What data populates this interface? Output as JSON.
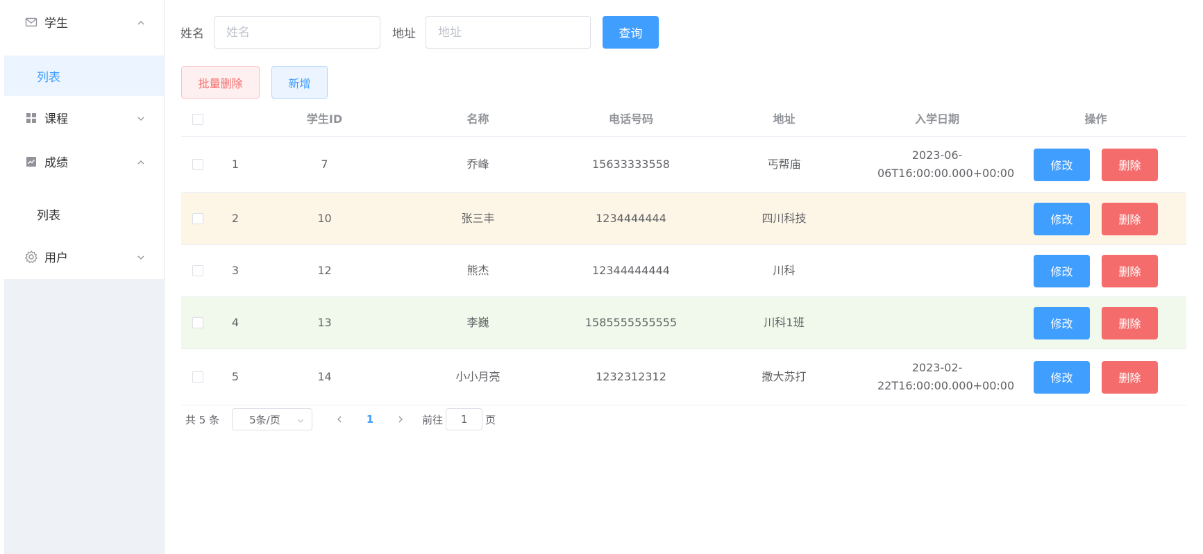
{
  "sidebar": {
    "menus": [
      {
        "title": "学生",
        "expanded": true,
        "icon": "mail-icon",
        "children": [
          "列表"
        ]
      },
      {
        "title": "课程",
        "expanded": false,
        "icon": "grid-icon",
        "children": []
      },
      {
        "title": "成绩",
        "expanded": true,
        "icon": "chart-icon",
        "children": [
          "列表"
        ]
      },
      {
        "title": "用户",
        "expanded": false,
        "icon": "gear-icon",
        "children": []
      }
    ]
  },
  "search": {
    "name_label": "姓名",
    "name_placeholder": "姓名",
    "addr_label": "地址",
    "addr_placeholder": "地址",
    "query_button": "查询"
  },
  "actions": {
    "batch_delete": "批量删除",
    "add": "新增"
  },
  "table": {
    "headers": [
      "学生ID",
      "名称",
      "电话号码",
      "地址",
      "入学日期",
      "操作"
    ],
    "rows": [
      {
        "index": "1",
        "id": "7",
        "name": "乔峰",
        "phone": "15633333558",
        "address": "丐帮庙",
        "date": "2023-06-06T16:00:00.000+00:00",
        "style": "normal"
      },
      {
        "index": "2",
        "id": "10",
        "name": "张三丰",
        "phone": "1234444444",
        "address": "四川科技",
        "date": "",
        "style": "warning"
      },
      {
        "index": "3",
        "id": "12",
        "name": "熊杰",
        "phone": "12344444444",
        "address": "川科",
        "date": "",
        "style": "normal"
      },
      {
        "index": "4",
        "id": "13",
        "name": "李巍",
        "phone": "1585555555555",
        "address": "川科1班",
        "date": "",
        "style": "success"
      },
      {
        "index": "5",
        "id": "14",
        "name": "小小月亮",
        "phone": "1232312312",
        "address": "撒大苏打",
        "date": "2023-02-22T16:00:00.000+00:00",
        "style": "normal"
      }
    ],
    "edit_label": "修改",
    "delete_label": "删除"
  },
  "pagination": {
    "total_text": "共 5 条",
    "page_size": "5条/页",
    "current_page": "1",
    "goto_label": "前往",
    "goto_value": "1",
    "page_suffix": "页"
  }
}
